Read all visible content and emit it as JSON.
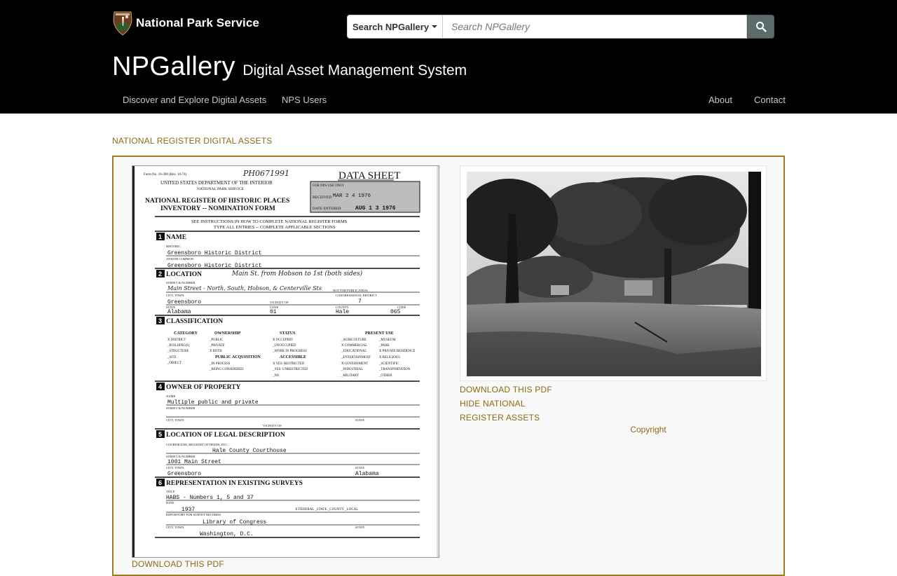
{
  "header": {
    "brand": "National Park Service",
    "search": {
      "scope_label": "Search NPGallery",
      "placeholder": "Search NPGallery"
    },
    "title_main": "NPGallery",
    "title_sub": "Digital Asset Management System",
    "nav": {
      "discover": "Discover and Explore Digital Assets",
      "nps_users": "NPS Users",
      "about": "About",
      "contact": "Contact"
    }
  },
  "breadcrumb": "NATIONAL REGISTER DIGITAL ASSETS",
  "asset": {
    "download_pdf": "DOWNLOAD THIS PDF",
    "hide_line1": "HIDE NATIONAL",
    "hide_line2": "REGISTER ASSETS",
    "copyright": "Copyright",
    "doc_download": "DOWNLOAD THIS PDF"
  },
  "form": {
    "form_no": "Form No. 10-300 (Rev. 10-74)",
    "handwritten_id": "PH0671991",
    "data_sheet": "DATA SHEET",
    "dept_line1": "UNITED STATES DEPARTMENT OF THE INTERIOR",
    "dept_line2": "NATIONAL PARK SERVICE",
    "title_line1": "NATIONAL REGISTER OF HISTORIC PLACES",
    "title_line2": "INVENTORY -- NOMINATION FORM",
    "nps_use": "FOR NPS USE ONLY",
    "received_label": "RECEIVED",
    "received_date": "MAR 2 4 1976",
    "entered_label": "DATE ENTERED",
    "entered_date": "AUG 1 3 1976",
    "instructions_1": "SEE INSTRUCTIONS IN HOW TO COMPLETE NATIONAL REGISTER FORMS",
    "instructions_2": "TYPE ALL ENTRIES -- COMPLETE APPLICABLE SECTIONS",
    "s1_num": "1",
    "s1_title": "NAME",
    "historic_label": "HISTORIC",
    "historic_value": "Greensboro Historic District",
    "common_label": "AND/OR COMMON",
    "common_value": "Greensboro Historic District",
    "s2_num": "2",
    "s2_title": "LOCATION",
    "location_note": "Main St. from Hobson to 1st (both sides)",
    "street_label": "STREET & NUMBER",
    "street_value": "Main Street - North, South, Hobson, & Centerville Sts",
    "not_pub": "NOT FOR PUBLICATION",
    "city_label": "CITY, TOWN",
    "city_value": "Greensboro",
    "vicinity_label": "VICINITY OF",
    "cong_label": "CONGRESSIONAL DISTRICT",
    "cong_value": "7",
    "state_label": "STATE",
    "state_value": "Alabama",
    "code_label": "CODE",
    "code_value": "01",
    "county_label": "COUNTY",
    "county_value": "Hale",
    "code2_value": "065",
    "s3_num": "3",
    "s3_title": "CLASSIFICATION",
    "cat_head": "CATEGORY",
    "own_head": "OWNERSHIP",
    "stat_head": "STATUS",
    "use_head": "PRESENT USE",
    "cat_items": [
      "X DISTRICT",
      "_BUILDING(S)",
      "_STRUCTURE",
      "_SITE",
      "_OBJECT"
    ],
    "own_items": [
      "_PUBLIC",
      "_PRIVATE",
      "X BOTH"
    ],
    "acq_head": "PUBLIC ACQUISITION",
    "acq_items": [
      "_IN PROCESS",
      "_BEING CONSIDERED"
    ],
    "stat_items": [
      "X OCCUPIED",
      "_UNOCCUPIED",
      "_WORK IN PROGRESS"
    ],
    "acc_head": "ACCESSIBLE",
    "acc_items": [
      "X YES: RESTRICTED",
      "_YES: UNRESTRICTED",
      "_NO"
    ],
    "use_items_a": [
      "_AGRICULTURE",
      "X COMMERCIAL",
      "_EDUCATIONAL",
      "_ENTERTAINMENT",
      "X GOVERNMENT",
      "_INDUSTRIAL",
      "_MILITARY"
    ],
    "use_items_b": [
      "_MUSEUM",
      "_PARK",
      "X PRIVATE RESIDENCE",
      "X RELIGIOUS",
      "_SCIENTIFIC",
      "_TRANSPORTATION",
      "_OTHER"
    ],
    "s4_num": "4",
    "s4_title": "OWNER OF PROPERTY",
    "name_label": "NAME",
    "owner_value": "Multiple public and private",
    "s5_num": "5",
    "s5_title": "LOCATION OF LEGAL DESCRIPTION",
    "courthouse_label": "COURTHOUSE, REGISTRY OF DEEDS, ETC.",
    "courthouse_value": "Hale County Courthouse",
    "street5_value": "1001 Main Street",
    "city5_value": "Greensboro",
    "state5_value": "Alabama",
    "s6_num": "6",
    "s6_title": "REPRESENTATION IN EXISTING SURVEYS",
    "title_label": "TITLE",
    "survey_title": "HABS - Numbers 1, 5 and 37",
    "date_label": "DATE",
    "survey_date": "1937",
    "survey_flags": "X FEDERAL  _STATE  _COUNTY  _LOCAL",
    "depository_label": "DEPOSITORY FOR SURVEY RECORDS",
    "depository_value": "Library of Congress",
    "city6_value": "Washington, D.C."
  }
}
